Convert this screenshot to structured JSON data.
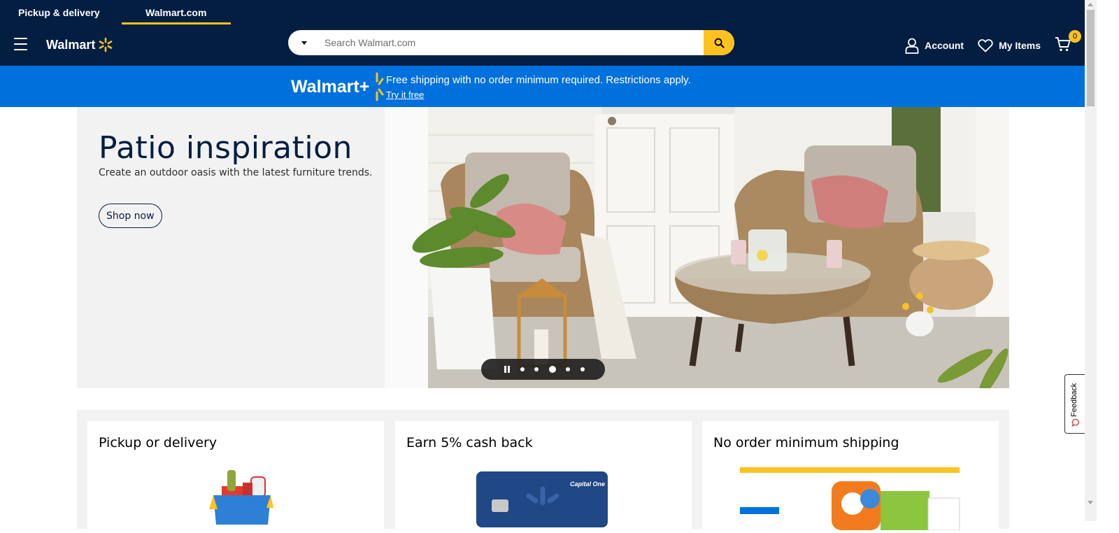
{
  "header": {
    "tabs": [
      {
        "label": "Pickup & delivery",
        "active": false
      },
      {
        "label": "Walmart.com",
        "active": true
      }
    ],
    "logo_text": "Walmart",
    "search": {
      "placeholder": "Search Walmart.com"
    },
    "account_label": "Account",
    "my_items_label": "My Items",
    "cart_count": "0"
  },
  "walmart_plus": {
    "logo_text": "Walmart+",
    "message": "Free shipping with no order minimum required. Restrictions apply.",
    "link": "Try it free"
  },
  "hero": {
    "title": "Patio inspiration",
    "subtitle": "Create an outdoor oasis with the latest furniture trends.",
    "cta": "Shop now",
    "slides": 5,
    "active_slide": 3
  },
  "cards": [
    {
      "title": "Pickup or delivery"
    },
    {
      "title": "Earn 5% cash back"
    },
    {
      "title": "No order minimum shipping"
    }
  ],
  "card_image_text": {
    "capital_one": "Capital One"
  },
  "feedback": {
    "label": "Feedback"
  },
  "colors": {
    "header_bg": "#041e42",
    "accent_yellow": "#ffc220",
    "wplus_blue": "#0071dc",
    "hero_bg": "#f2f2f2"
  }
}
